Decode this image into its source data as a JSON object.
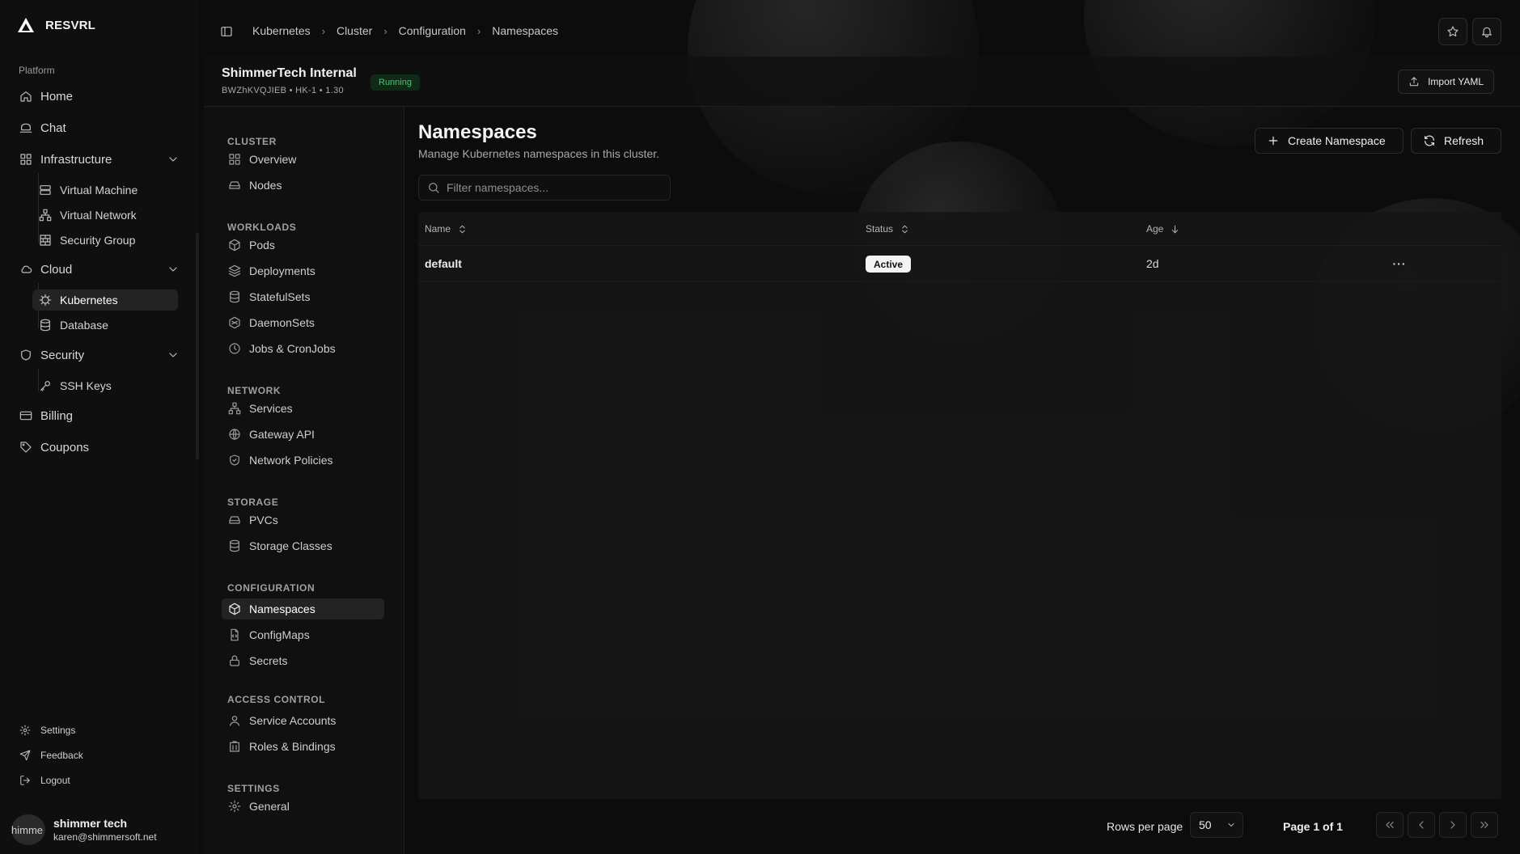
{
  "app": {
    "brand": "RESVRL"
  },
  "sidebar": {
    "group_label": "Platform",
    "home": "Home",
    "chat": "Chat",
    "infrastructure": {
      "label": "Infrastructure",
      "items": [
        "Virtual Machine",
        "Virtual Network",
        "Security Group"
      ]
    },
    "cloud": {
      "label": "Cloud",
      "items": [
        "Kubernetes",
        "Database"
      ]
    },
    "security": {
      "label": "Security",
      "items": [
        "SSH Keys"
      ]
    },
    "billing": "Billing",
    "coupons": "Coupons",
    "footer": {
      "settings": "Settings",
      "feedback": "Feedback",
      "logout": "Logout"
    },
    "user": {
      "avatar_text": "himme",
      "name": "shimmer tech",
      "email": "karen@shimmersoft.net"
    }
  },
  "breadcrumb": [
    "Kubernetes",
    "Cluster",
    "Configuration",
    "Namespaces"
  ],
  "cluster": {
    "name": "ShimmerTech Internal",
    "meta": "BWZhKVQJIEB  •  HK-1  •  1.30",
    "status": "Running",
    "import_label": "Import YAML"
  },
  "resource_nav": {
    "cluster": {
      "label": "CLUSTER",
      "items": [
        "Overview",
        "Nodes"
      ]
    },
    "workloads": {
      "label": "WORKLOADS",
      "items": [
        "Pods",
        "Deployments",
        "StatefulSets",
        "DaemonSets",
        "Jobs & CronJobs"
      ]
    },
    "network": {
      "label": "NETWORK",
      "items": [
        "Services",
        "Gateway API",
        "Network Policies"
      ]
    },
    "storage": {
      "label": "STORAGE",
      "items": [
        "PVCs",
        "Storage Classes"
      ]
    },
    "configuration": {
      "label": "CONFIGURATION",
      "items": [
        "Namespaces",
        "ConfigMaps",
        "Secrets"
      ]
    },
    "access_control": {
      "label": "ACCESS CONTROL",
      "items": [
        "Service Accounts",
        "Roles & Bindings"
      ]
    },
    "settings": {
      "label": "SETTINGS",
      "items": [
        "General"
      ]
    }
  },
  "main": {
    "title": "Namespaces",
    "subtitle": "Manage Kubernetes namespaces in this cluster.",
    "create_label": "Create Namespace",
    "refresh_label": "Refresh",
    "filter_placeholder": "Filter namespaces...",
    "columns": {
      "name": "Name",
      "status": "Status",
      "age": "Age"
    },
    "rows": [
      {
        "name": "default",
        "status": "Active",
        "age": "2d"
      }
    ],
    "row_menu": "···",
    "pagination": {
      "rows_label": "Rows per page",
      "rows_value": "50",
      "page_label": "Page 1 of 1"
    }
  },
  "colors": {
    "background": "#0c0c0c",
    "running_text": "#3ecf6a",
    "running_bg": "#0f2a17",
    "active_badge_bg": "#f4f4f4"
  }
}
